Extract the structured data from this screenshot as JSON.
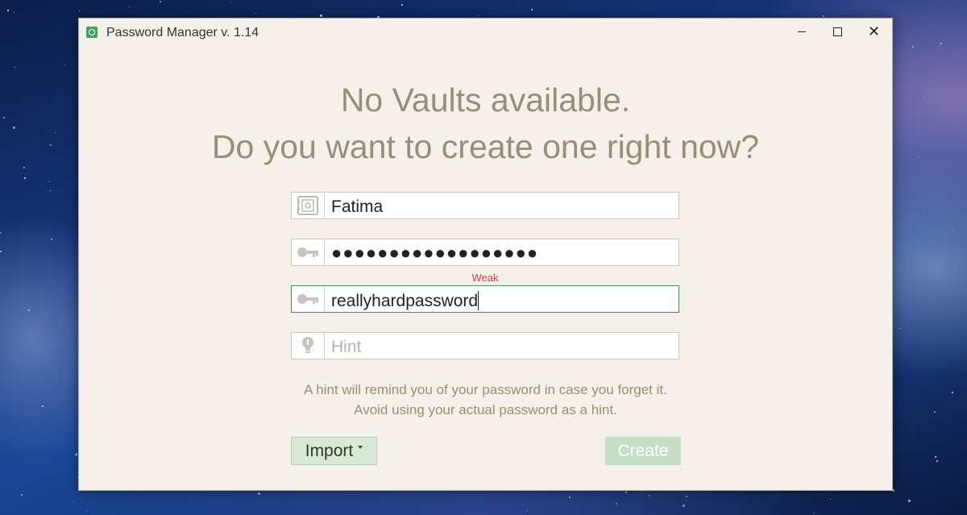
{
  "window": {
    "title": "Password Manager v. 1.14",
    "controls": {
      "minimize": "minimize",
      "maximize": "maximize",
      "close": "close"
    }
  },
  "main": {
    "heading_line1": "No Vaults available.",
    "heading_line2": "Do you want to create one right now?"
  },
  "form": {
    "vault_name": {
      "value": "Fatima",
      "icon": "vault-icon"
    },
    "password": {
      "value": "●●●●●●●●●●●●●●●●●●",
      "icon": "key-icon"
    },
    "strength": {
      "label": "Weak",
      "color": "#d63c3c"
    },
    "confirm_password": {
      "value": "reallyhardpassword",
      "icon": "key-icon"
    },
    "hint": {
      "value": "",
      "placeholder": "Hint",
      "icon": "lightbulb-icon"
    },
    "help_line1": "A hint will remind you of your password in case you forget it.",
    "help_line2": "Avoid using your actual password as a hint."
  },
  "buttons": {
    "import_label": "Import",
    "create_label": "Create"
  },
  "colors": {
    "accent": "#3f8f57",
    "heading": "#9a8d77",
    "window_bg": "#f5f1ea"
  }
}
